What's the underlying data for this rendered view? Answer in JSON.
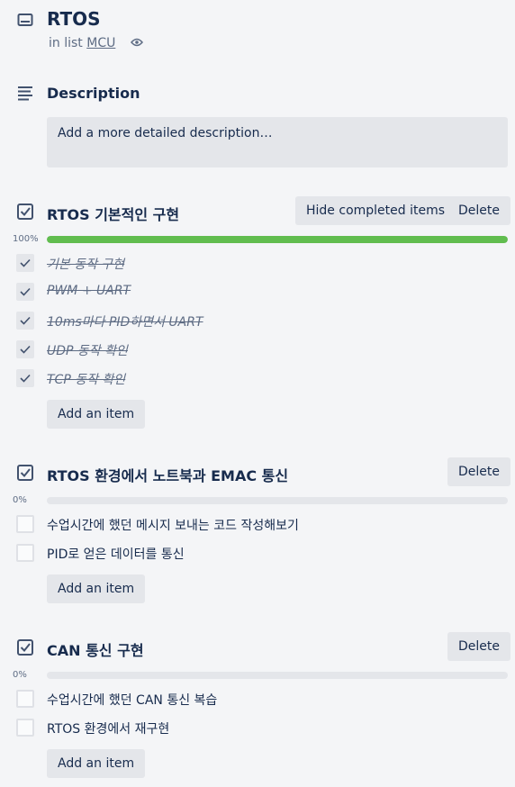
{
  "card": {
    "title": "RTOS",
    "in_list_prefix": "in list",
    "list_name": "MCU"
  },
  "description": {
    "heading": "Description",
    "placeholder": "Add a more detailed description…"
  },
  "checklists": [
    {
      "title": "RTOS 기본적인 구현",
      "hide_label": "Hide completed items",
      "delete_label": "Delete",
      "percent_label": "100%",
      "progress": 1.0,
      "items": [
        {
          "text": "기본 동작 구현",
          "done": true
        },
        {
          "text": "PWM + UART",
          "done": true
        },
        {
          "text": "10ms마다 PID하면서 UART",
          "done": true
        },
        {
          "text": "UDP 동작 확인",
          "done": true
        },
        {
          "text": "TCP 동작 확인",
          "done": true
        }
      ],
      "add_label": "Add an item"
    },
    {
      "title": "RTOS 환경에서 노트북과 EMAC 통신",
      "delete_label": "Delete",
      "percent_label": "0%",
      "progress": 0.0,
      "items": [
        {
          "text": "수업시간에 했던 메시지 보내는 코드 작성해보기",
          "done": false
        },
        {
          "text": "PID로 얻은 데이터를 통신",
          "done": false
        }
      ],
      "add_label": "Add an item"
    },
    {
      "title": "CAN 통신 구현",
      "delete_label": "Delete",
      "percent_label": "0%",
      "progress": 0.0,
      "items": [
        {
          "text": "수업시간에 했던 CAN 통신 복습",
          "done": false
        },
        {
          "text": "RTOS 환경에서 재구현",
          "done": false
        }
      ],
      "add_label": "Add an item"
    }
  ],
  "colors": {
    "progress_complete": "#61bd4f",
    "progress_track": "#e4e6ea",
    "button_bg": "#e4e6ea"
  },
  "icons": {
    "card": "card-icon",
    "watch": "eye-icon",
    "description": "description-icon",
    "checklist": "checklist-icon",
    "check": "check-icon"
  }
}
